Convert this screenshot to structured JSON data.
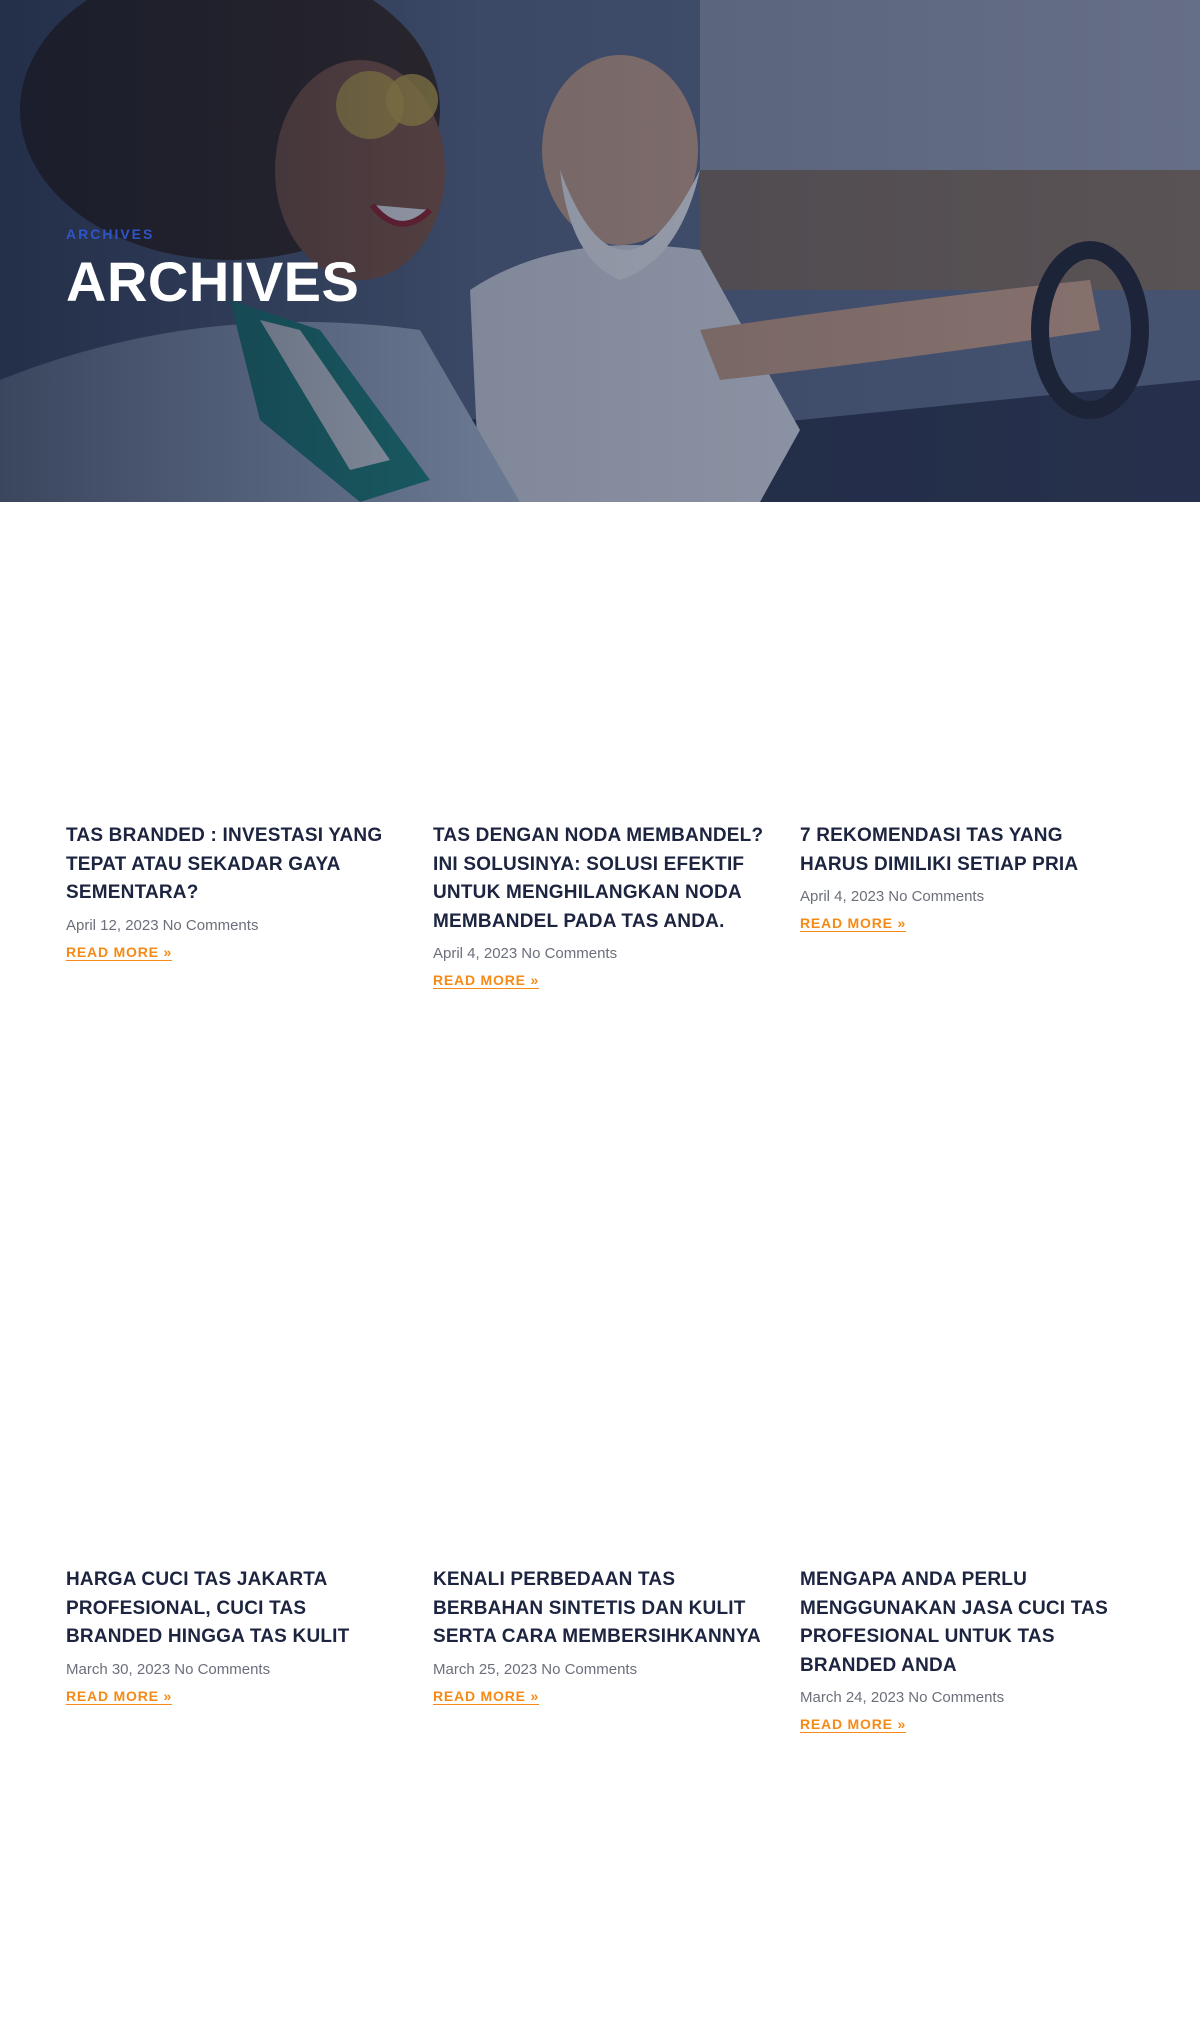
{
  "hero": {
    "kicker": "ARCHIVES",
    "title": "ARCHIVES",
    "image": "people-in-convertible-car-photo"
  },
  "posts": [
    {
      "title": "TAS BRANDED : INVESTASI YANG TEPAT ATAU SEKADAR GAYA SEMENTARA?",
      "date": "April 12, 2023",
      "comments": "No Comments",
      "read_more": "READ MORE »"
    },
    {
      "title": "TAS DENGAN NODA MEMBANDEL? INI SOLUSINYA: SOLUSI EFEKTIF UNTUK MENGHILANGKAN NODA MEMBANDEL PADA TAS ANDA.",
      "date": "April 4, 2023",
      "comments": "No Comments",
      "read_more": "READ MORE »"
    },
    {
      "title": "7 REKOMENDASI TAS YANG HARUS DIMILIKI SETIAP PRIA",
      "date": "April 4, 2023",
      "comments": "No Comments",
      "read_more": "READ MORE »"
    },
    {
      "title": "HARGA CUCI TAS JAKARTA PROFESIONAL, CUCI TAS BRANDED HINGGA TAS KULIT",
      "date": "March 30, 2023",
      "comments": "No Comments",
      "read_more": "READ MORE »"
    },
    {
      "title": "KENALI PERBEDAAN TAS BERBAHAN SINTETIS DAN KULIT SERTA CARA MEMBERSIHKANNYA",
      "date": "March 25, 2023",
      "comments": "No Comments",
      "read_more": "READ MORE »"
    },
    {
      "title": "MENGAPA ANDA PERLU MENGGUNAKAN JASA CUCI TAS PROFESIONAL UNTUK TAS BRANDED ANDA",
      "date": "March 24, 2023",
      "comments": "No Comments",
      "read_more": "READ MORE »"
    }
  ],
  "colors": {
    "accent": "#f58a16",
    "kicker": "#2f54c7",
    "heading": "#1c2440"
  }
}
